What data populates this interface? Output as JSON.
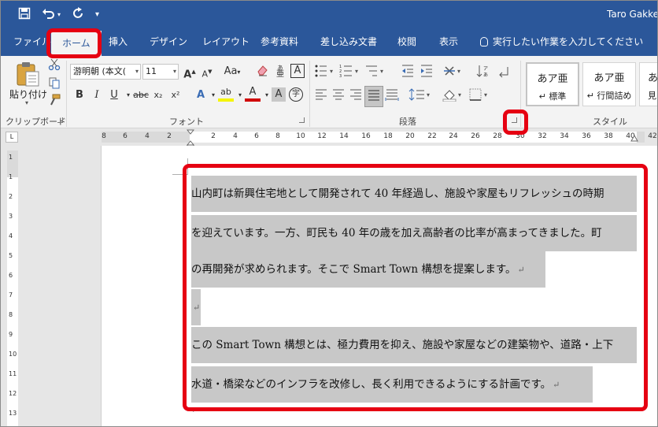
{
  "window": {
    "user_name": "Taro Gakke"
  },
  "qat": {
    "save_icon": "save-icon",
    "undo_icon": "undo-icon",
    "redo_icon": "redo-icon",
    "customize_icon": "customize-qat-icon"
  },
  "tabs": [
    {
      "label": "ファイル"
    },
    {
      "label": "ホーム"
    },
    {
      "label": "挿入"
    },
    {
      "label": "デザイン"
    },
    {
      "label": "レイアウト"
    },
    {
      "label": "参考資料"
    },
    {
      "label": "差し込み文書"
    },
    {
      "label": "校閲"
    },
    {
      "label": "表示"
    }
  ],
  "tell_me": "実行したい作業を入力してください",
  "clipboard": {
    "paste_label": "貼り付け",
    "group_label": "クリップボード"
  },
  "font": {
    "font_name": "游明朝 (本文(",
    "font_size": "11",
    "group_label": "フォント",
    "bold": "B",
    "italic": "I",
    "underline": "U",
    "strike": "abc",
    "subscript": "x₂",
    "superscript": "x²",
    "grow": "A",
    "shrink": "A",
    "change_case": "Aa",
    "char_border": "A",
    "font_color_letter": "A",
    "highlight_letter": "ab",
    "shade_letter": "A",
    "enclose_letter": "字"
  },
  "paragraph": {
    "group_label": "段落"
  },
  "styles": {
    "group_label": "スタイル",
    "items": [
      {
        "preview": "あア亜",
        "name": "↵ 標準"
      },
      {
        "preview": "あア亜",
        "name": "↵ 行間詰め"
      },
      {
        "preview": "あ",
        "name": "見"
      }
    ]
  },
  "ruler": {
    "h_ticks": [
      "8",
      "6",
      "4",
      "2",
      "2",
      "4",
      "6",
      "8",
      "10",
      "12",
      "14",
      "16",
      "18",
      "20",
      "22",
      "24",
      "26",
      "28",
      "30",
      "32",
      "34",
      "36",
      "38",
      "40",
      "42"
    ],
    "v_ticks": [
      "1",
      "1",
      "2",
      "3",
      "4",
      "5",
      "6",
      "7",
      "8",
      "9",
      "10",
      "11",
      "12",
      "13"
    ]
  },
  "document": {
    "lines": [
      "山内町は新興住宅地として開発されて 40 年経過し、施設や家屋もリフレッシュの時期",
      "を迎えています。一方、町民も 40 年の歳を加え高齢者の比率が高まってきました。町",
      "の再開発が求められます。そこで Smart Town 構想を提案します。",
      "",
      "この Smart Town 構想とは、極力費用を抑え、施設や家屋などの建築物や、道路・上下",
      "水道・橋梁などのインフラを改修し、長く利用できるようにする計画です。"
    ],
    "return_mark": "↵"
  }
}
